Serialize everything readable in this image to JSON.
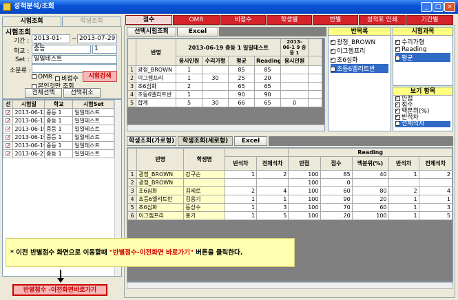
{
  "window": {
    "title": "성적분석/조회",
    "min": "_",
    "max": "□",
    "close": "×"
  },
  "left": {
    "tabs": [
      "시험조회",
      "학생조회"
    ],
    "section_title": "시험조회",
    "period_label": "기간 :",
    "date_from": "2013-01-29",
    "tilde": "~",
    "date_to": "2013-07-29",
    "school_label": "학교 :",
    "school": "중등",
    "grade": "1",
    "set_label": "Set :",
    "set": "일일테스트",
    "subgroup_label": "소분류 :",
    "chk_omr": "OMR",
    "chk_nonscore": "비점수",
    "chk_mine": "본인것만 조회",
    "search_btn": "시험검색",
    "select_all_btn": "전체선택",
    "deselect_btn": "선택취소",
    "cols": [
      "선",
      "시험일",
      "학교",
      "시험Set",
      "소"
    ],
    "rows": [
      [
        "2013-06-12",
        "중등 1",
        "일일테스트"
      ],
      [
        "2013-06-12",
        "중등 1",
        "일일테스트"
      ],
      [
        "2013-06-19",
        "중등 1",
        "일일테스트"
      ],
      [
        "2013-06-19",
        "중등 1",
        "일일테스트"
      ],
      [
        "2013-06-19",
        "중등 1",
        "일일테스트"
      ],
      [
        "2013-06-27",
        "중등 1",
        "일일테스트"
      ]
    ],
    "bottom_btn": "반별점수 -이전화면바로가기"
  },
  "top_tabs": [
    "점수",
    "OMR",
    "비점수",
    "학생별",
    "반별",
    "성적표 인쇄",
    "기간별"
  ],
  "upper": {
    "btn_view": "선택시험조회",
    "btn_excel": "Excel",
    "col_class": "반명",
    "exam_title": "2013-06-19 중등 1 일일테스트",
    "exam_title2": "2013-06-1 9 중등 1",
    "sub": [
      "응시인원",
      "수리가형",
      "평균",
      "Reading",
      "응시인원"
    ],
    "rows": [
      {
        "n": "1",
        "name": "광정_BROWN",
        "a": "1",
        "b": "",
        "avg": "85",
        "r": "85",
        "x": ""
      },
      {
        "n": "2",
        "name": "이그젬프리",
        "a": "1",
        "b": "30",
        "avg": "25",
        "r": "20",
        "x": ""
      },
      {
        "n": "3",
        "name": "초6심화",
        "a": "2",
        "b": "",
        "avg": "65",
        "r": "65",
        "x": ""
      },
      {
        "n": "4",
        "name": "초등6엘리트반",
        "a": "1",
        "b": "",
        "avg": "90",
        "r": "90",
        "x": ""
      },
      {
        "n": "5",
        "name": "합계",
        "a": "5",
        "b": "30",
        "avg": "66",
        "r": "65",
        "x": "0"
      }
    ]
  },
  "classlist": {
    "title": "반목록",
    "items": [
      "광정_BROWN",
      "이그젬프리",
      "초6심화",
      "초등6엘리트반"
    ]
  },
  "subjects": {
    "title": "시험과목",
    "items": [
      "수리가형",
      "Reading",
      "평균"
    ]
  },
  "viewitems": {
    "title": "보기 항목",
    "items": [
      "만점",
      "점수",
      "백분위(%)",
      "반석차",
      "전체석차"
    ]
  },
  "lower": {
    "btn_h": "학생조회(가로형)",
    "btn_v": "학생조회(세로형)",
    "btn_excel": "Excel",
    "col_class": "반명",
    "col_student": "학생명",
    "group1": [
      "반석차",
      "전체석차"
    ],
    "reading": "Reading",
    "group2": [
      "만점",
      "점수",
      "백분위(%)",
      "반석차",
      "전체석차"
    ],
    "rows": [
      {
        "n": "1",
        "cls": "광정_BROWN",
        "stu": "강구슨",
        "r1": "1",
        "t1": "2",
        "full": "100",
        "sc": "85",
        "pct": "40",
        "r2": "1",
        "t2": "2"
      },
      {
        "n": "2",
        "cls": "광정_BROWN",
        "stu": "",
        "r1": "",
        "t1": "",
        "full": "100",
        "sc": "0",
        "pct": "",
        "r2": "",
        "t2": ""
      },
      {
        "n": "3",
        "cls": "초6심화",
        "stu": "김세로",
        "r1": "2",
        "t1": "4",
        "full": "100",
        "sc": "60",
        "pct": "80",
        "r2": "2",
        "t2": "4"
      },
      {
        "n": "4",
        "cls": "초등6엘리트반",
        "stu": "김용기",
        "r1": "1",
        "t1": "1",
        "full": "100",
        "sc": "90",
        "pct": "20",
        "r2": "1",
        "t2": "1"
      },
      {
        "n": "5",
        "cls": "초6심화",
        "stu": "동상수",
        "r1": "1",
        "t1": "3",
        "full": "100",
        "sc": "70",
        "pct": "60",
        "r2": "1",
        "t2": "3"
      },
      {
        "n": "6",
        "cls": "이그젬프리",
        "stu": "홍기",
        "r1": "1",
        "t1": "5",
        "full": "100",
        "sc": "20",
        "pct": "100",
        "r2": "1",
        "t2": "5"
      }
    ]
  },
  "callout": {
    "pre": "* 이전 반별점수 화면으로 이동할때 ",
    "quote": "\"반별점수-이전화면 바로가기\"",
    "post": " 버튼을 클릭한다."
  }
}
